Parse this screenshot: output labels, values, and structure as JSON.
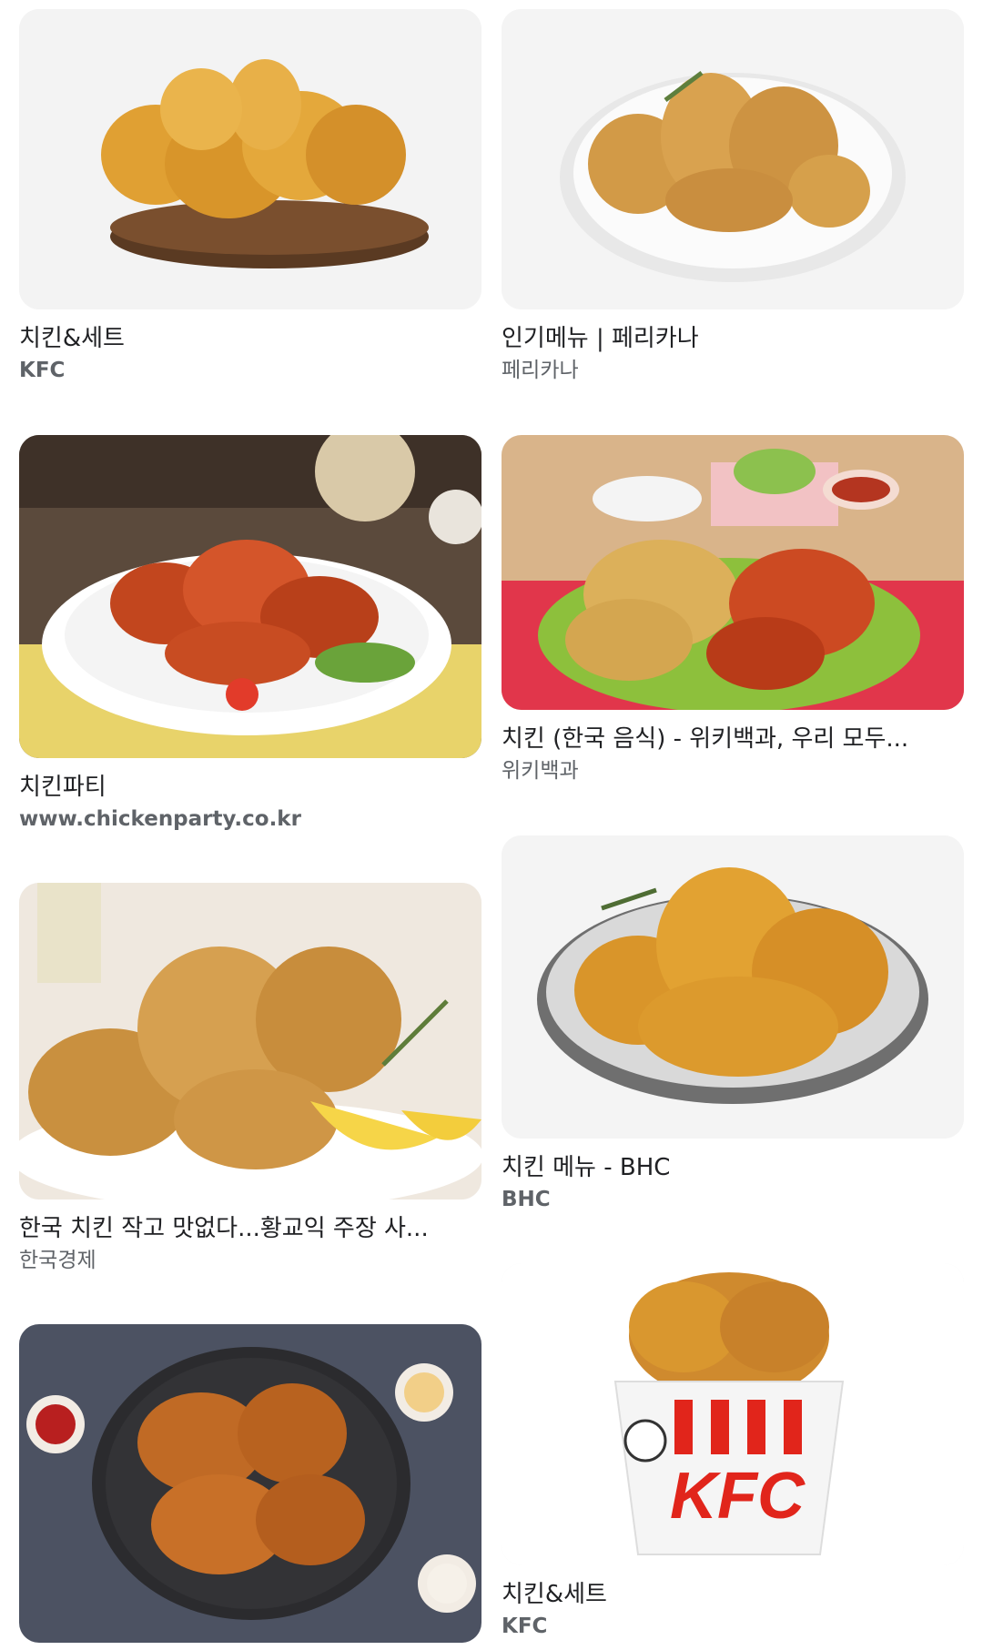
{
  "results": [
    {
      "title": "치킨&세트",
      "source": "KFC",
      "image": "fried-chicken-on-wooden-board"
    },
    {
      "title": "인기메뉴 | 페리카나",
      "source": "페리카나",
      "image": "fried-chicken-on-white-plate"
    },
    {
      "title": "치킨파티",
      "source": "www.chickenparty.co.kr",
      "image": "spicy-glazed-chicken-plate"
    },
    {
      "title": "치킨 (한국 음식) - 위키백과, 우리 모두...",
      "source": "위키백과",
      "image": "half-and-half-chicken-plate"
    },
    {
      "title": "한국 치킨 작고 맛없다...황교익 주장 사...",
      "source": "한국경제",
      "image": "crispy-chicken-with-lemon"
    },
    {
      "title": "치킨 메뉴 - BHC",
      "source": "BHC",
      "image": "seasoned-crumb-chicken-plate"
    },
    {
      "title": "",
      "source": "",
      "image": "fried-chicken-dark-plate-with-dips"
    },
    {
      "title": "치킨&세트",
      "source": "KFC",
      "image": "kfc-bucket"
    }
  ],
  "bucket_logo_text": "KFC"
}
